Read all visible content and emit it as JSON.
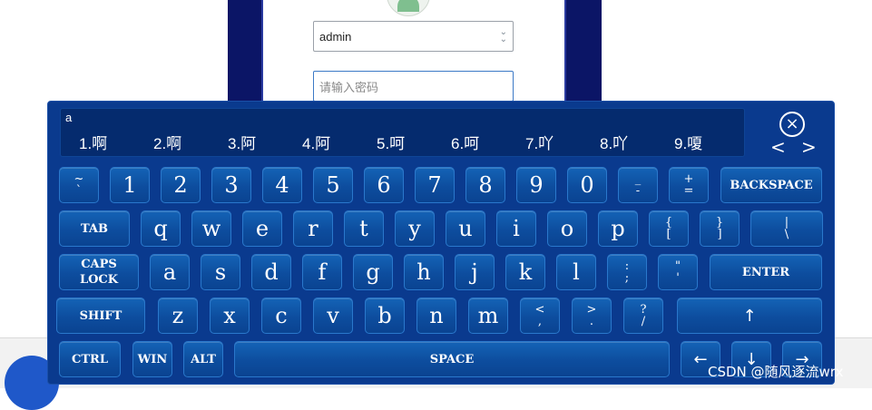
{
  "login": {
    "username_value": "admin",
    "password_placeholder": "请输入密码"
  },
  "keyboard": {
    "composition": "a",
    "candidates": [
      "1.啊",
      "2.啊",
      "3.阿",
      "4.阿",
      "5.呵",
      "6.呵",
      "7.吖",
      "8.吖",
      "9.嗄"
    ],
    "close_icon": "×",
    "prev_page": "<",
    "next_page": ">",
    "rows": [
      [
        "~\n`",
        "1",
        "2",
        "3",
        "4",
        "5",
        "6",
        "7",
        "8",
        "9",
        "0",
        "_\n-",
        "+\n=",
        "BACKSPACE"
      ],
      [
        "TAB",
        "q",
        "w",
        "e",
        "r",
        "t",
        "y",
        "u",
        "i",
        "o",
        "p",
        "{\n[",
        "}\n]",
        "|\n\\"
      ],
      [
        "CAPS\nLOCK",
        "a",
        "s",
        "d",
        "f",
        "g",
        "h",
        "j",
        "k",
        "l",
        ":\n;",
        "\"\n'",
        "ENTER"
      ],
      [
        "SHIFT",
        "z",
        "x",
        "c",
        "v",
        "b",
        "n",
        "m",
        "<\n,",
        ">\n.",
        "?\n/",
        "↑"
      ],
      [
        "CTRL",
        "WIN",
        "ALT",
        "SPACE",
        "←",
        "↓",
        "→"
      ]
    ]
  },
  "watermark": "CSDN @随风逐流wrx"
}
